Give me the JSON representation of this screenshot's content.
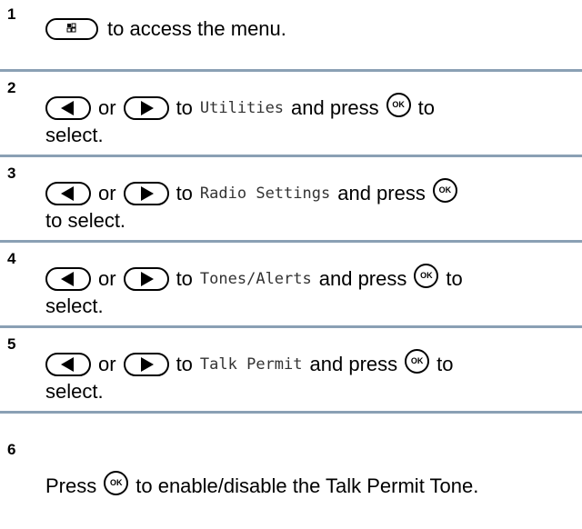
{
  "steps": [
    {
      "number": "1",
      "parts": {
        "tail": "to access the menu."
      }
    },
    {
      "number": "2",
      "parts": {
        "or": "or",
        "to": "to",
        "code": "Utilities",
        "press": "and press",
        "ok": "OK",
        "tail": "to",
        "wrap": "select."
      }
    },
    {
      "number": "3",
      "parts": {
        "or": "or",
        "to": "to",
        "code": "Radio Settings",
        "press": "and press",
        "ok": "OK",
        "wrap": "to select."
      }
    },
    {
      "number": "4",
      "parts": {
        "or": "or",
        "to": "to",
        "code": "Tones/Alerts",
        "press": "and press",
        "ok": "OK",
        "tail": "to",
        "wrap": "select."
      }
    },
    {
      "number": "5",
      "parts": {
        "or": "or",
        "to": "to",
        "code": "Talk Permit",
        "press": "and press",
        "ok": "OK",
        "tail": "to",
        "wrap": "select."
      }
    },
    {
      "number": "6",
      "parts": {
        "press": "Press",
        "ok": "OK",
        "tail": "to enable/disable the Talk Permit Tone."
      }
    }
  ],
  "icons": {
    "menu_button": "menu-button-icon",
    "left_arrow": "left-arrow-button-icon",
    "right_arrow": "right-arrow-button-icon",
    "ok_button": "ok-button-icon"
  },
  "colors": {
    "separator": "#8aa0b4"
  }
}
